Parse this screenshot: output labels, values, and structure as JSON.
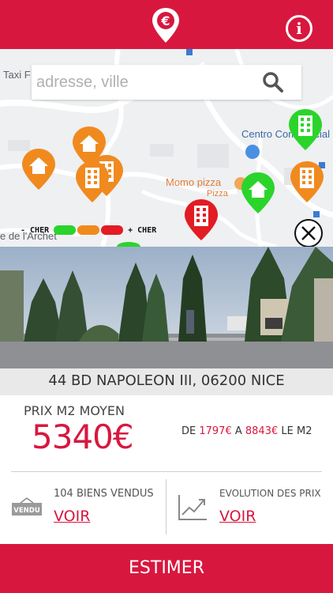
{
  "header": {
    "logo_icon": "euro-location-pin-icon",
    "info_label": "i"
  },
  "map": {
    "labels": {
      "taxi": "Taxi F",
      "centro": "Centro Commercial",
      "momo": "Momo pizza",
      "pizza": "Pizza",
      "archet": "e de l'Archet"
    },
    "pins": [
      {
        "type": "house",
        "color": "#f08a1f"
      },
      {
        "type": "house",
        "color": "#f08a1f"
      },
      {
        "type": "building",
        "color": "#f08a1f"
      },
      {
        "type": "building",
        "color": "#f08a1f"
      },
      {
        "type": "building",
        "color": "#e31b23"
      },
      {
        "type": "house",
        "color": "#2bd42b"
      },
      {
        "type": "building",
        "color": "#2bd42b"
      },
      {
        "type": "building",
        "color": "#f08a1f"
      }
    ]
  },
  "search": {
    "placeholder": "adresse, ville",
    "value": ""
  },
  "legend": {
    "left_label": "- CHER",
    "right_label": "+ CHER",
    "colors": [
      "#2bd42b",
      "#f08a1f",
      "#e31b23"
    ]
  },
  "address": "44 BD NAPOLEON III, 06200 NICE",
  "price": {
    "label": "PRIX M2 MOYEN",
    "value": "5340€",
    "range_prefix": "DE ",
    "range_min": "1797€",
    "range_mid": " A ",
    "range_max": "8843€",
    "range_suffix": " LE M2"
  },
  "sold": {
    "icon_text": "VENDU",
    "count_label": "104 BIENS VENDUS",
    "link_label": "VOIR"
  },
  "evolution": {
    "label": "EVOLUTION DES PRIX",
    "link_label": "VOIR"
  },
  "footer": {
    "button_label": "ESTIMER"
  },
  "colors": {
    "brand_red": "#d8173f"
  }
}
